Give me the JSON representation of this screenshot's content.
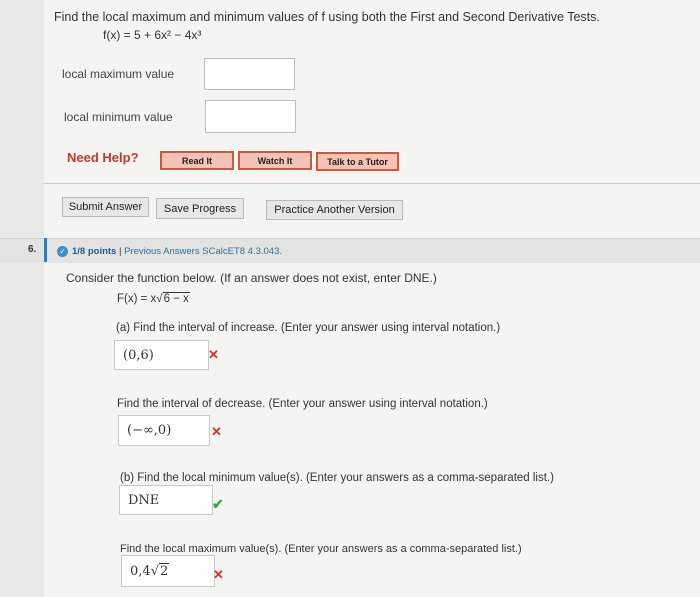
{
  "q5": {
    "prompt": "Find the local maximum and minimum values of f using both the First and Second Derivative Tests.",
    "function": "f(x) = 5 + 6x² − 4x³",
    "local_max_label": "local maximum value",
    "local_min_label": "local minimum value",
    "need_help": "Need Help?",
    "buttons": {
      "read": "Read It",
      "watch": "Watch It",
      "talk": "Talk to a Tutor"
    },
    "actions": {
      "submit": "Submit Answer",
      "save": "Save Progress",
      "practice": "Practice Another Version"
    }
  },
  "q6": {
    "number": "6.",
    "points": "1/8 points",
    "previous_answers": "Previous Answers",
    "code": "SCalcET8 4.3.043.",
    "instructions": "Consider the function below. (If an answer does not exist, enter DNE.)",
    "function_lhs": "F(x) = x",
    "function_radicand": "6 − x",
    "part_a_increase": "(a) Find the interval of increase. (Enter your answer using interval notation.)",
    "answer_increase": "(0,6)",
    "decrease_prompt": "Find the interval of decrease. (Enter your answer using interval notation.)",
    "answer_decrease": "(−∞,0)",
    "part_b_min": "(b) Find the local minimum value(s). (Enter your answers as a comma-separated list.)",
    "answer_min": "DNE",
    "max_prompt": "Find the local maximum value(s). (Enter your answers as a comma-separated list.)",
    "answer_max_prefix": "0,4",
    "answer_max_radicand": "2"
  },
  "marks": {
    "wrong": "✕",
    "correct": "✔"
  }
}
